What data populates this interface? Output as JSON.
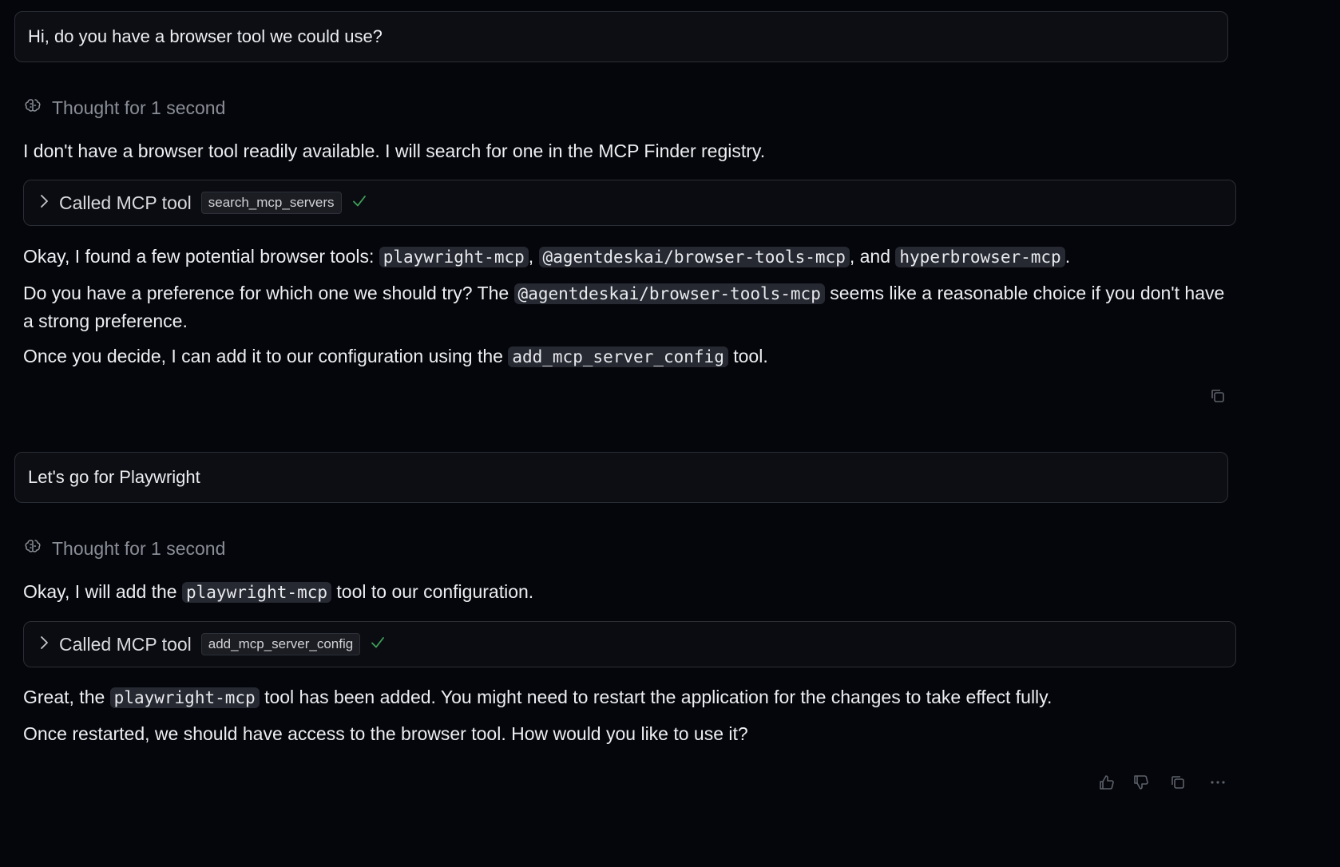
{
  "messages": {
    "user1": "Hi, do you have a browser tool we could use?",
    "thought1": "Thought for 1 second",
    "assistant1": {
      "intro": "I don't have a browser tool readily available. I will search for one in the MCP Finder registry.",
      "tool_call_label": "Called MCP tool",
      "tool_call_name": "search_mcp_servers",
      "p1_a": "Okay, I found a few potential browser tools: ",
      "p1_code1": "playwright-mcp",
      "p1_b": ", ",
      "p1_code2": "@agentdeskai/browser-tools-mcp",
      "p1_c": ", and ",
      "p1_code3": "hyperbrowser-mcp",
      "p1_d": ".",
      "p2_a": "Do you have a preference for which one we should try? The ",
      "p2_code": "@agentdeskai/browser-tools-mcp",
      "p2_b": " seems like a reasonable choice if you don't have a strong preference.",
      "p3_a": "Once you decide, I can add it to our configuration using the ",
      "p3_code": "add_mcp_server_config",
      "p3_b": " tool."
    },
    "user2": "Let's go for Playwright",
    "thought2": "Thought for 1 second",
    "assistant2": {
      "intro_a": "Okay, I will add the ",
      "intro_code": "playwright-mcp",
      "intro_b": " tool to our configuration.",
      "tool_call_label": "Called MCP tool",
      "tool_call_name": "add_mcp_server_config",
      "p1_a": "Great, the ",
      "p1_code": "playwright-mcp",
      "p1_b": " tool has been added. You might need to restart the application for the changes to take effect fully.",
      "p2": "Once restarted, we should have access to the browser tool. How would you like to use it?"
    }
  },
  "icons": {
    "thought": "brain-icon",
    "tool_expand": "chevron-right-icon",
    "tool_status": "checkmark-icon",
    "copy": "copy-icon",
    "thumbs_up": "thumbs-up-icon",
    "thumbs_down": "thumbs-down-icon",
    "more": "more-icon"
  },
  "colors": {
    "background": "#05060b",
    "text": "#eceef1",
    "muted": "#8a8e96",
    "code_bg": "#262931",
    "success": "#3fa05a"
  }
}
